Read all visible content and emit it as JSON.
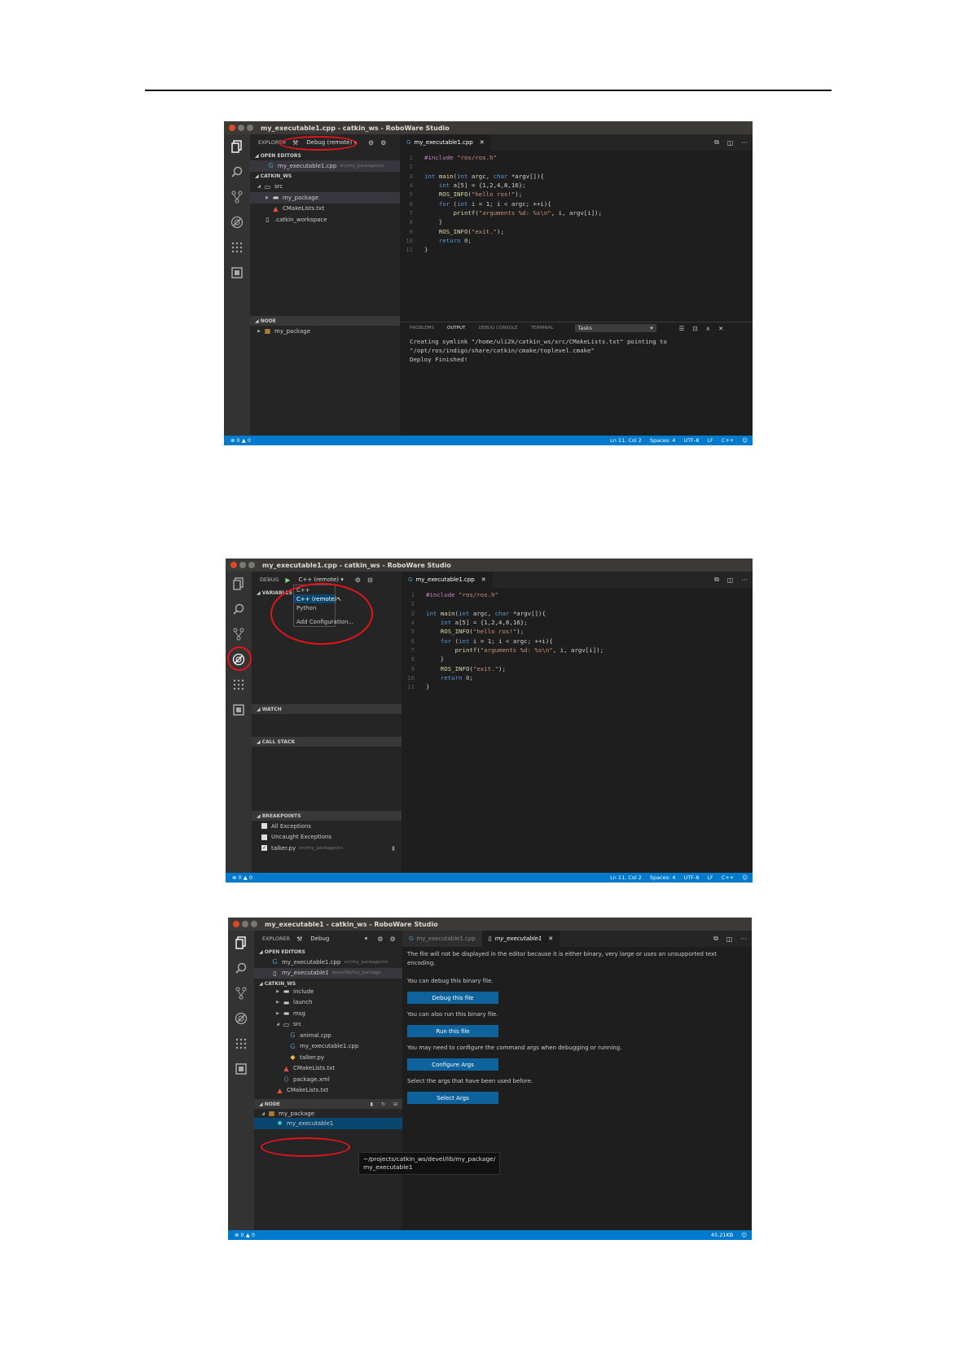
{
  "shot1": {
    "window_title": "my_executable1.cpp - catkin_ws - RoboWare Studio",
    "sidebar": {
      "header": "EXPLORER",
      "config": "Debug (remote)",
      "open_editors_title": "OPEN EDITORS",
      "open_editor_file": "my_executable1.cpp",
      "open_editor_path": "src/my_package/src",
      "workspace_title": "CATKIN_WS",
      "tree": [
        "src",
        "my_package",
        "CMakeLists.txt",
        ".catkin_workspace"
      ],
      "node_title": "NODE",
      "node_item": "my_package"
    },
    "tab": "my_executable1.cpp",
    "panel": {
      "tabs": [
        "PROBLEMS",
        "OUTPUT",
        "DEBUG CONSOLE",
        "TERMINAL"
      ],
      "select": "Tasks",
      "output": [
        "Creating symlink \"/home/uli2k/catkin_ws/src/CMakeLists.txt\" pointing to",
        "\"/opt/ros/indigo/share/catkin/cmake/toplevel.cmake\"",
        "Deploy Finished!"
      ]
    },
    "status": {
      "problems": "0",
      "warnings": "0",
      "position": "Ln 11, Col 2",
      "spaces": "Spaces: 4",
      "encoding": "UTF-8",
      "eol": "LF",
      "language": "C++"
    }
  },
  "shot2": {
    "window_title": "my_executable1.cpp - catkin_ws - RoboWare Studio",
    "sidebar": {
      "header": "DEBUG",
      "config": "C++ (remote)",
      "variables_title": "VARIABLES",
      "watch_title": "WATCH",
      "callstack_title": "CALL STACK",
      "breakpoints_title": "BREAKPOINTS",
      "breakpoints": [
        "All Exceptions",
        "Uncaught Exceptions",
        "talker.py"
      ],
      "breakpoint_path": "src/my_package/src"
    },
    "dropdown": [
      "C++",
      "C++ (remote)",
      "Python",
      "Add Configuration..."
    ],
    "tab": "my_executable1.cpp",
    "status": {
      "problems": "0",
      "warnings": "0",
      "position": "Ln 11, Col 2",
      "spaces": "Spaces: 4",
      "encoding": "UTF-8",
      "eol": "LF",
      "language": "C++"
    }
  },
  "shot3": {
    "window_title": "my_executable1 - catkin_ws - RoboWare Studio",
    "sidebar": {
      "header": "EXPLORER",
      "config": "Debug",
      "open_editors_title": "OPEN EDITORS",
      "open_file_1": "my_executable1.cpp",
      "open_path_1": "src/my_package/src",
      "open_file_2": "my_executable1",
      "open_path_2": "devel/lib/my_package",
      "workspace_title": "CATKIN_WS",
      "tree": [
        "include",
        "launch",
        "msg",
        "src",
        "animal.cpp",
        "my_executable1.cpp",
        "talker.py",
        "CMakeLists.txt",
        "package.xml",
        "CMakeLists.txt"
      ],
      "node_title": "NODE",
      "node_package": "my_package",
      "node_exec": "my_executable1"
    },
    "tabs": [
      "my_executable1.cpp",
      "my_executable1"
    ],
    "messages": [
      "The file will not be displayed in the editor because it is either binary, very large or uses an unsupported text",
      "encoding.",
      "You can debug this binary file.",
      "You can also run this binary file.",
      "You may need to configure the command args when debugging or running.",
      "Select the args that have been used before."
    ],
    "buttons": [
      "Debug this file",
      "Run this file",
      "Configure Args",
      "Select Args"
    ],
    "tooltip": [
      "~/projects/catkin_ws/devel/lib/my_package/",
      "my_executable1"
    ],
    "status": {
      "problems": "0",
      "warnings": "0",
      "size": "45.21KB"
    }
  },
  "code_lines": [
    [
      {
        "t": "pp",
        "v": "#include "
      },
      {
        "t": "str",
        "v": "\"ros/ros.h\""
      }
    ],
    [],
    [
      {
        "t": "kw",
        "v": "int "
      },
      {
        "t": "fn",
        "v": "main"
      },
      {
        "t": "cc",
        "v": "("
      },
      {
        "t": "kw",
        "v": "int "
      },
      {
        "t": "cc",
        "v": "argc, "
      },
      {
        "t": "kw",
        "v": "char "
      },
      {
        "t": "cc",
        "v": "*argv[]){"
      }
    ],
    [
      {
        "t": "cc",
        "v": "    "
      },
      {
        "t": "kw",
        "v": "int "
      },
      {
        "t": "cc",
        "v": "a[5] = {1,2,4,8,16};"
      }
    ],
    [
      {
        "t": "cc",
        "v": "    "
      },
      {
        "t": "fn",
        "v": "ROS_INFO"
      },
      {
        "t": "cc",
        "v": "("
      },
      {
        "t": "str",
        "v": "\"hello ros!\""
      },
      {
        "t": "cc",
        "v": ");"
      }
    ],
    [
      {
        "t": "cc",
        "v": "    "
      },
      {
        "t": "kw",
        "v": "for "
      },
      {
        "t": "cc",
        "v": "("
      },
      {
        "t": "kw",
        "v": "int "
      },
      {
        "t": "cc",
        "v": "i = 1; i < argc; ++i){"
      }
    ],
    [
      {
        "t": "cc",
        "v": "        "
      },
      {
        "t": "fn",
        "v": "printf"
      },
      {
        "t": "cc",
        "v": "("
      },
      {
        "t": "str",
        "v": "\"arguments %d: %s\\n\""
      },
      {
        "t": "cc",
        "v": ", i, argv[i]);"
      }
    ],
    [
      {
        "t": "cc",
        "v": "    }"
      }
    ],
    [
      {
        "t": "cc",
        "v": "    "
      },
      {
        "t": "fn",
        "v": "ROS_INFO"
      },
      {
        "t": "cc",
        "v": "("
      },
      {
        "t": "str",
        "v": "\"exit.\""
      },
      {
        "t": "cc",
        "v": ");"
      }
    ],
    [
      {
        "t": "cc",
        "v": "    "
      },
      {
        "t": "kw",
        "v": "return "
      },
      {
        "t": "num",
        "v": "0"
      },
      {
        "t": "cc",
        "v": ";"
      }
    ],
    [
      {
        "t": "cc",
        "v": "}"
      }
    ]
  ],
  "colors": {
    "statusbar": "#007acc",
    "highlight_ring": "#e4141b",
    "button": "#0e639c",
    "selection": "#094771"
  }
}
